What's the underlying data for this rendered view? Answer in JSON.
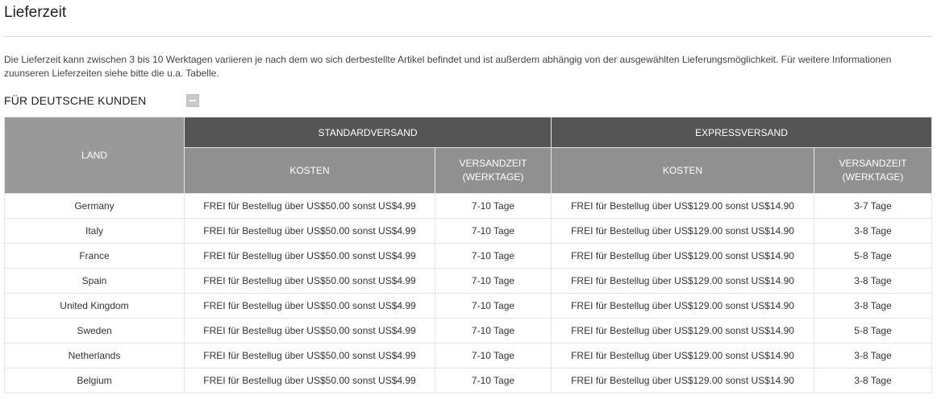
{
  "page": {
    "title": "Lieferzeit",
    "intro": "Die Lieferzeit kann zwischen 3 bis 10 Werktagen variieren je nach dem wo sich derbestellte Artikel befindet und ist außerdem abhängig von der ausgewählten Lieferungsmöglichkeit. Für weitere Informationen zuunseren Lieferzeiten siehe bitte die u.a. Tabelle.",
    "section_label": "FÜR DEUTSCHE KUNDEN",
    "collapse_icon": "minus-icon"
  },
  "table": {
    "headers": {
      "land": "LAND",
      "standard": "STANDARDVERSAND",
      "express": "EXPRESSVERSAND",
      "std_cost": "KOSTEN",
      "std_time_1": "VERSANDZEIT",
      "std_time_2": "(WERKTAGE)",
      "exp_cost": "KOSTEN",
      "exp_time_1": "VERSANDZEIT",
      "exp_time_2": "(WERKTAGE)"
    },
    "rows": [
      {
        "land": "Germany",
        "std_cost": "FREI für Bestellug über US$50.00 sonst US$4.99",
        "std_time": "7-10 Tage",
        "exp_cost": "FREI für Bestellug über US$129.00 sonst US$14.90",
        "exp_time": "3-7 Tage"
      },
      {
        "land": "Italy",
        "std_cost": "FREI für Bestellug über US$50.00 sonst US$4.99",
        "std_time": "7-10 Tage",
        "exp_cost": "FREI für Bestellug über US$129.00 sonst US$14.90",
        "exp_time": "3-8 Tage"
      },
      {
        "land": "France",
        "std_cost": "FREI für Bestellug über US$50.00 sonst US$4.99",
        "std_time": "7-10 Tage",
        "exp_cost": "FREI für Bestellug über US$129.00 sonst US$14.90",
        "exp_time": "5-8 Tage"
      },
      {
        "land": "Spain",
        "std_cost": "FREI für Bestellug über US$50.00 sonst US$4.99",
        "std_time": "7-10 Tage",
        "exp_cost": "FREI für Bestellug über US$129.00 sonst US$14.90",
        "exp_time": "3-8 Tage"
      },
      {
        "land": "United Kingdom",
        "std_cost": "FREI für Bestellug über US$50.00 sonst US$4.99",
        "std_time": "7-10 Tage",
        "exp_cost": "FREI für Bestellug über US$129.00 sonst US$14.90",
        "exp_time": "3-8 Tage"
      },
      {
        "land": "Sweden",
        "std_cost": "FREI für Bestellug über US$50.00 sonst US$4.99",
        "std_time": "7-10 Tage",
        "exp_cost": "FREI für Bestellug über US$129.00 sonst US$14.90",
        "exp_time": "5-8 Tage"
      },
      {
        "land": "Netherlands",
        "std_cost": "FREI für Bestellug über US$50.00 sonst US$4.99",
        "std_time": "7-10 Tage",
        "exp_cost": "FREI für Bestellug über US$129.00 sonst US$14.90",
        "exp_time": "3-8 Tage"
      },
      {
        "land": "Belgium",
        "std_cost": "FREI für Bestellug über US$50.00 sonst US$4.99",
        "std_time": "7-10 Tage",
        "exp_cost": "FREI für Bestellug über US$129.00 sonst US$14.90",
        "exp_time": "3-8 Tage"
      }
    ]
  }
}
